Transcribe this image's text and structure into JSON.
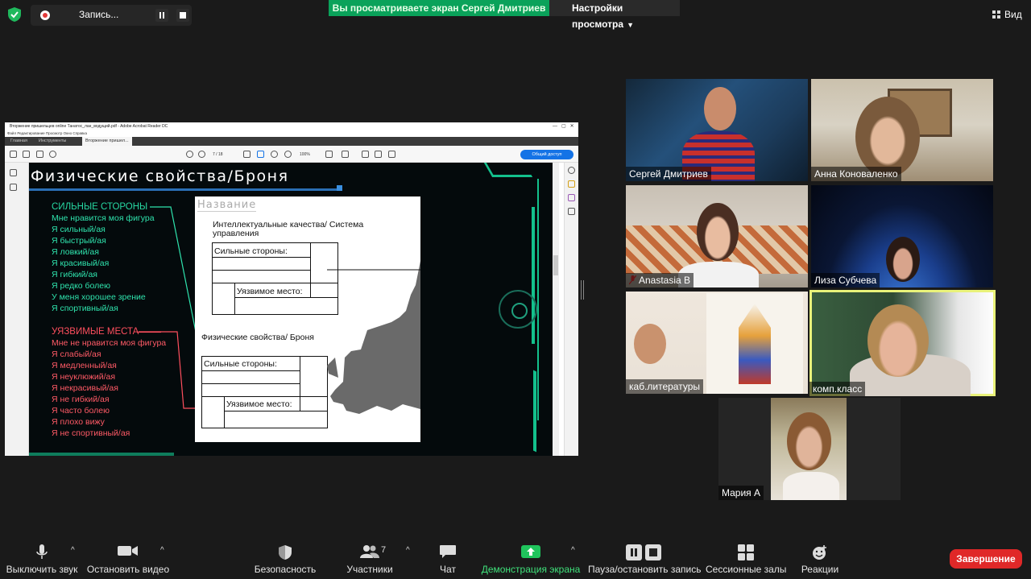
{
  "top_bar": {
    "record_label": "Запись...",
    "share_banner": "Вы просматриваете экран Сергей Дмитриев",
    "view_settings": "Настройки просмотра",
    "view_button": "Вид"
  },
  "acrobat": {
    "window_title": "Вторжение пришельцев online Танатос_лан_водущий.pdf - Adobe Acrobat Reader DC",
    "menu": "Файл  Редактирование  Просмотр  Окно  Справка",
    "tabs": [
      "Главная",
      "Инструменты",
      "Вторжение пришел..."
    ],
    "page_indicator": "7 / 18",
    "zoom": "100%",
    "share_button": "Общий доступ"
  },
  "slide": {
    "title": "Физические свойства/Броня",
    "strong_heading": "СИЛЬНЫЕ СТОРОНЫ",
    "strong_items": [
      "Мне нравится моя фигура",
      "Я сильный/ая",
      "Я быстрый/ая",
      "Я ловкий/ая",
      "Я красивый/ая",
      "Я гибкий/ая",
      "Я редко болею",
      "У меня хорошее зрение",
      "Я спортивный/ая"
    ],
    "weak_heading": "УЯЗВИМЫЕ МЕСТА",
    "weak_items": [
      "Мне не нравится моя фигура",
      "Я слабый/ая",
      "Я медленный/ая",
      "Я неуклюжий/ая",
      "Я некрасивый/ая",
      "Я не гибкий/ая",
      "Я часто болею",
      "Я плохо вижу",
      "Я не спортивный/ая"
    ],
    "card": {
      "name": "Название",
      "section1": "Интеллектуальные качества/ Система управления",
      "strong_label": "Сильные стороны:",
      "weak_label": "Уязвимое место:",
      "section2": "Физические свойства/ Броня"
    }
  },
  "participants": [
    {
      "name": "Сергей Дмитриев",
      "muted": false
    },
    {
      "name": "Анна Коноваленко",
      "muted": false
    },
    {
      "name": "Anastasia B",
      "muted": true
    },
    {
      "name": "Лиза Субчева",
      "muted": false
    },
    {
      "name": "каб.литературы",
      "muted": false
    },
    {
      "name": "комп.класс",
      "muted": false,
      "active_speaker": true
    },
    {
      "name": "Мария А",
      "muted": false
    }
  ],
  "toolbar": {
    "mute": "Выключить звук",
    "video": "Остановить видео",
    "security": "Безопасность",
    "participants": "Участники",
    "participants_count": "7",
    "chat": "Чат",
    "share": "Демонстрация экрана",
    "record": "Пауза/остановить запись",
    "breakout": "Сессионные залы",
    "reactions": "Реакции",
    "end": "Завершение"
  },
  "colors": {
    "share_banner": "#0aa25a",
    "end_button": "#e02828",
    "strong_text": "#2fe3ad",
    "weak_text": "#ff5a66",
    "active_speaker_border": "#e9f27a"
  }
}
